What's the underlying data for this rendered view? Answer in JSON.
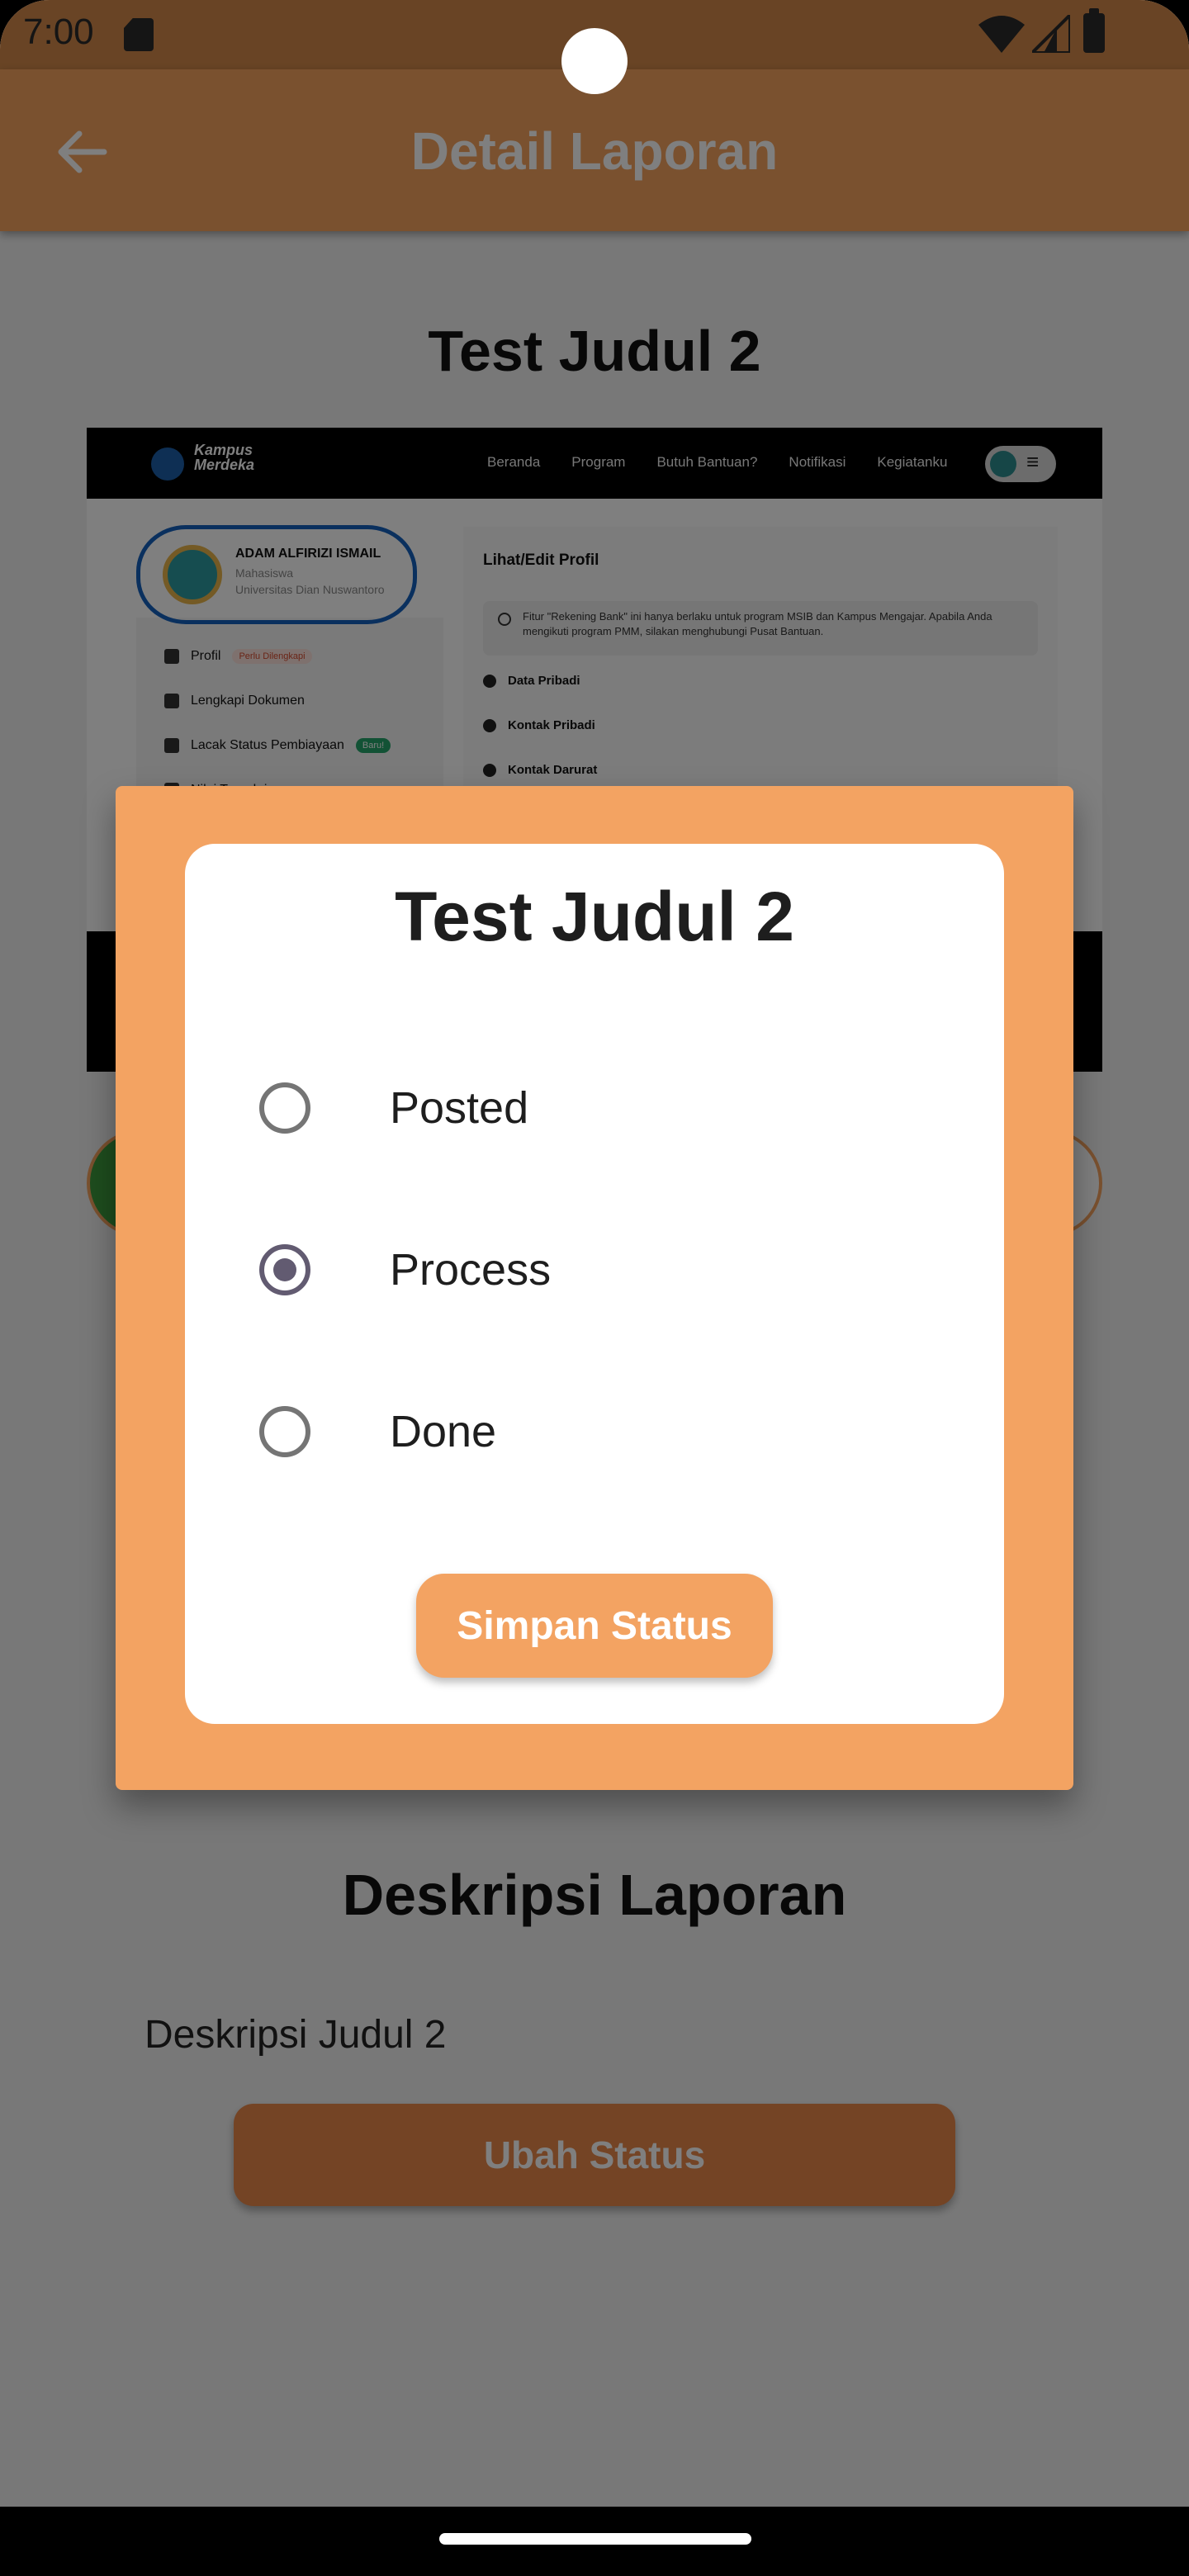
{
  "status_bar": {
    "time": "7:00"
  },
  "app_bar": {
    "title": "Detail Laporan"
  },
  "report": {
    "title": "Test Judul 2",
    "screenshot": {
      "logo_line1": "Kampus",
      "logo_line2": "Merdeka",
      "nav_items": [
        "Beranda",
        "Program",
        "Butuh Bantuan?",
        "Notifikasi",
        "Kegiatanku"
      ],
      "user_name": "ADAM ALFIRIZI ISMAIL",
      "user_role": "Mahasiswa",
      "user_university": "Universitas Dian Nuswantoro",
      "menu": [
        {
          "label": "Profil",
          "badge": "Perlu Dilengkapi"
        },
        {
          "label": "Lengkapi Dokumen",
          "badge": ""
        },
        {
          "label": "Lacak Status Pembiayaan",
          "badge": "Baru!"
        },
        {
          "label": "Nilai Transkrip",
          "badge": ""
        }
      ],
      "right_title": "Lihat/Edit Profil",
      "info_text": "Fitur \"Rekening Bank\" ini hanya berlaku untuk program MSIB dan Kampus Mengajar. Apabila Anda mengikuti program PMM, silakan menghubungi Pusat Bantuan.",
      "sections": [
        "Data Pribadi",
        "Kontak Pribadi",
        "Kontak Darurat"
      ]
    },
    "description_heading": "Deskripsi Laporan",
    "description": "Deskripsi Judul 2",
    "change_status_label": "Ubah Status"
  },
  "dialog": {
    "title": "Test Judul 2",
    "options": [
      {
        "label": "Posted",
        "selected": false
      },
      {
        "label": "Process",
        "selected": true
      },
      {
        "label": "Done",
        "selected": false
      }
    ],
    "save_label": "Simpan Status"
  },
  "colors": {
    "accent": "#f3a362",
    "app_bar": "#f5a25f",
    "radio_selected": "#625b71"
  }
}
